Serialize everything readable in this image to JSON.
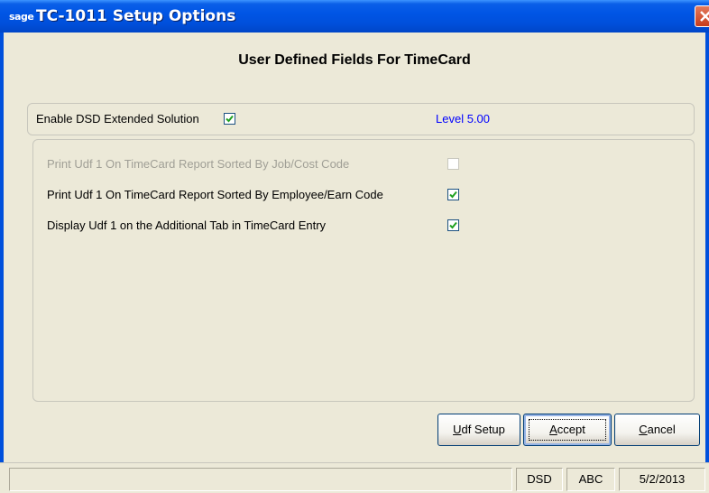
{
  "window": {
    "logo_text": "sage",
    "title": "TC-1011  Setup Options"
  },
  "dialog": {
    "heading": "User Defined Fields For TimeCard",
    "enable_label": "Enable DSD Extended Solution",
    "enable_checked": true,
    "level": "Level  5.00",
    "options": [
      {
        "label": "Print Udf 1 On TimeCard Report Sorted By Job/Cost Code",
        "checked": false,
        "enabled": false
      },
      {
        "label": "Print Udf 1 On TimeCard Report Sorted By Employee/Earn Code",
        "checked": true,
        "enabled": true
      },
      {
        "label": "Display Udf 1 on  the Additional Tab in TimeCard Entry",
        "checked": true,
        "enabled": true
      }
    ]
  },
  "buttons": {
    "udf_setup": {
      "accel": "U",
      "rest": "df Setup"
    },
    "accept": {
      "accel": "A",
      "rest": "ccept"
    },
    "cancel": {
      "accel": "C",
      "rest": "ancel"
    }
  },
  "statusbar": {
    "message": "",
    "company_group": "DSD",
    "company_code": "ABC",
    "date": "5/2/2013"
  },
  "colors": {
    "titlebar": "#0055e5",
    "level_text": "#0000ff",
    "check_mark": "#21a121",
    "window_bg": "#ece9d8"
  }
}
